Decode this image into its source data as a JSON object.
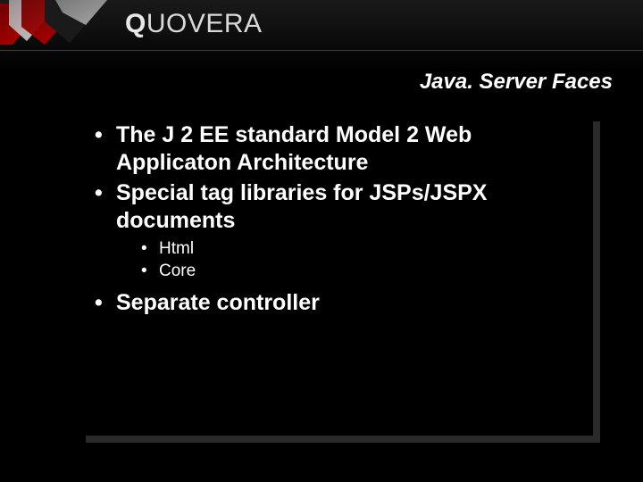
{
  "brand": {
    "name_markup_pre": "Q",
    "name_markup_post": "UOVERA"
  },
  "slide": {
    "title": "Java. Server Faces",
    "bullets": [
      {
        "text": "The J 2 EE standard Model 2 Web Applicaton Architecture",
        "children": []
      },
      {
        "text": "Special tag libraries for JSPs/JSPX documents",
        "children": [
          {
            "text": "Html"
          },
          {
            "text": "Core"
          }
        ]
      },
      {
        "text": "Separate controller",
        "children": []
      }
    ]
  }
}
